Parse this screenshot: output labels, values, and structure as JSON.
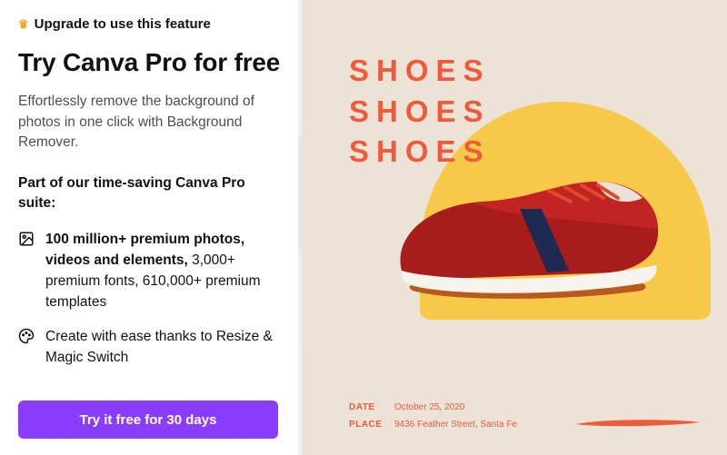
{
  "side": {
    "upgrade_banner": "Upgrade to use this feature",
    "title": "Try Canva Pro for free",
    "description": "Effortlessly remove the background of photos in one click with Background Remover.",
    "suite_intro": "Part of our time-saving Canva Pro suite:",
    "features": [
      {
        "lead": "100 million+ premium photos, videos and elements,",
        "rest": " 3,000+ premium fonts, 610,000+ premium templates"
      },
      {
        "lead": "",
        "rest": "Create with ease thanks to Resize & Magic Switch"
      }
    ],
    "cta_label": "Try it free for 30 days"
  },
  "design": {
    "headline_line1": "SHOES",
    "headline_line2": "SHOES",
    "headline_line3": "SHOES",
    "date_label": "DATE",
    "date_value": "October 25, 2020",
    "place_label": "PLACE",
    "place_value": "9436 Feather Street, Santa Fe"
  },
  "colors": {
    "accent_purple": "#8b3dff",
    "canvas_bg": "#ece2d6",
    "blob_yellow": "#f7c948",
    "text_orange": "#ef5a3a"
  }
}
